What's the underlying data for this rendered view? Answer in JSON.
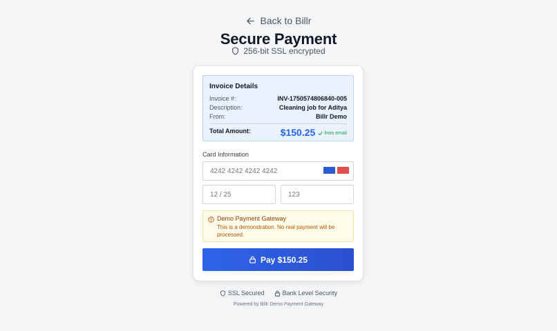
{
  "header": {
    "back_label": "Back to Billr",
    "title": "Secure Payment",
    "ssl_note": "256-bit SSL encrypted"
  },
  "invoice": {
    "title": "Invoice Details",
    "rows": [
      {
        "label": "Invoice #:",
        "value": "INV-1750574806840-005"
      },
      {
        "label": "Description:",
        "value": "Cleaning job for Aditya"
      },
      {
        "label": "From:",
        "value": "Billr Demo"
      }
    ],
    "total_label": "Total Amount:",
    "total_value": "$150.25",
    "from_email": "from email"
  },
  "card_form": {
    "section_label": "Card Information",
    "card_number_placeholder": "4242 4242 4242 4242",
    "expiry_placeholder": "12 / 25",
    "cvc_placeholder": "123",
    "brand_colors": {
      "primary": "#2d5bd6",
      "secondary": "#e24c4c"
    }
  },
  "notice": {
    "title": "Demo Payment Gateway",
    "body": "This is a demonstration. No real payment will be processed."
  },
  "pay_button": {
    "label": "Pay $150.25"
  },
  "footer": {
    "badges": [
      "SSL Secured",
      "Bank Level Security"
    ],
    "powered_by": "Powered by Billr Demo Payment Gateway"
  },
  "colors": {
    "accent": "#2563eb",
    "success": "#16a34a",
    "warning": "#b45309"
  }
}
